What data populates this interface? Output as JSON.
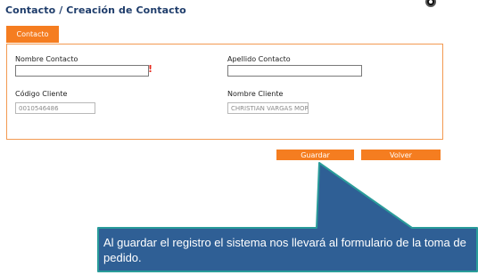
{
  "page": {
    "title": "Contacto / Creación de Contacto"
  },
  "tab": {
    "label": "Contacto"
  },
  "form": {
    "nombre_contacto": {
      "label": "Nombre Contacto",
      "value": "",
      "required_mark": "!"
    },
    "apellido_contacto": {
      "label": "Apellido Contacto",
      "value": ""
    },
    "codigo_cliente": {
      "label": "Código Cliente",
      "value": "0010546486"
    },
    "nombre_cliente": {
      "label": "Nombre Cliente",
      "value": "CHRISTIAN VARGAS MORE"
    }
  },
  "buttons": {
    "guardar": "Guardar",
    "volver": "Volver"
  },
  "callout": {
    "text": "Al guardar el registro el sistema nos llevará al formulario de la toma de pedido."
  },
  "colors": {
    "accent": "#f57d20",
    "title": "#1f3d6b",
    "callout_fill": "#2f5f95",
    "callout_border": "#2a9c9a",
    "required": "#e8281c"
  },
  "icons": {
    "help": "help-icon"
  }
}
